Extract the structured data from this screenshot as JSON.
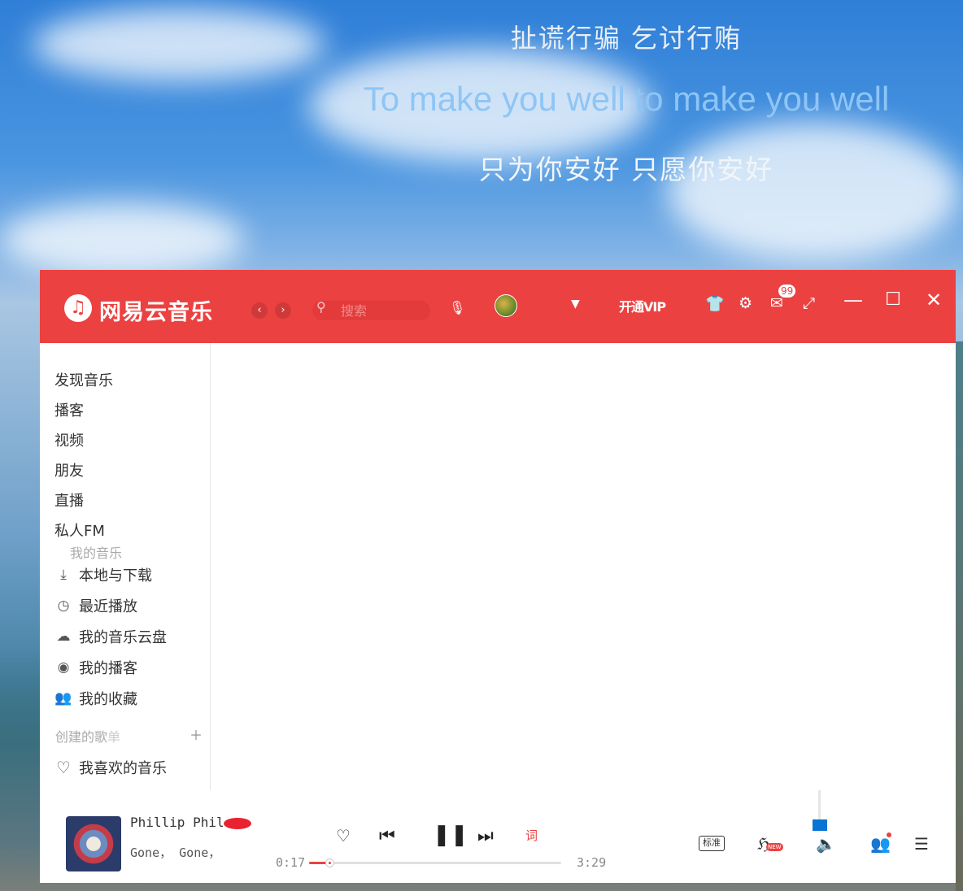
{
  "lyrics": {
    "line1": "扯谎行骗 乞讨行贿",
    "line2": "To make you well to make you well",
    "line3": "只为你安好 只愿你安好"
  },
  "titlebar": {
    "brand": "网易云音乐",
    "logo_icon": "netease-cloud-music-logo",
    "back_icon": "chevron-left-icon",
    "forward_icon": "chevron-right-icon",
    "search_placeholder": "搜索",
    "vip_label": "开通VIP",
    "message_badge": "99",
    "accent_color": "#ec4141"
  },
  "sidebar": {
    "nav": [
      "发现音乐",
      "播客",
      "视频",
      "朋友",
      "直播",
      "私人FM"
    ],
    "my_music_title": "我的音乐",
    "my_music": [
      {
        "icon": "download-icon",
        "label": "本地与下载"
      },
      {
        "icon": "recent-play-icon",
        "label": "最近播放"
      },
      {
        "icon": "cloud-icon",
        "label": "我的音乐云盘"
      },
      {
        "icon": "podcast-icon",
        "label": "我的播客"
      },
      {
        "icon": "favorites-icon",
        "label": "我的收藏"
      }
    ],
    "created_title": "创建的歌单",
    "created_truncated": "创建的歌\u0001",
    "playlists": [
      {
        "icon": "heart-icon",
        "label": "我喜欢的音乐"
      }
    ]
  },
  "player": {
    "song_name": "Phillip Phil",
    "artist": "Gone， Gone，",
    "current_time": "0:17",
    "total_time": "3:29",
    "progress": 0.08,
    "volume": 0.3,
    "quality_label": "标准",
    "new_tag": "NEW"
  }
}
